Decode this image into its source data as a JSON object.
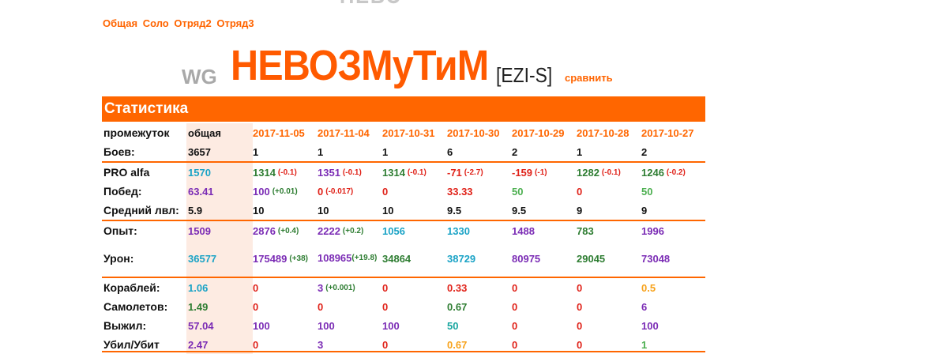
{
  "top_partial_title": "НЕВО",
  "modes": [
    "Общая",
    "Соло",
    "Отряд2",
    "Отряд3"
  ],
  "player": {
    "server": "WG",
    "nickname": "НЕВОЗМуТиМ",
    "clan": "[EZI-S]",
    "compare_label": "сравнить"
  },
  "stats_header": "Статистика",
  "colors": {
    "accent": "#ff6600",
    "black": "#111111",
    "cyan": "#1ba3c6",
    "green": "#2e7d32",
    "lightgreen": "#4caf50",
    "red": "#e0231a",
    "purple": "#7b2cb5",
    "orange": "#f7a21b",
    "teal": "#1aa6a0"
  },
  "table": {
    "columns": [
      "общая",
      "2017-11-05",
      "2017-11-04",
      "2017-10-31",
      "2017-10-30",
      "2017-10-29",
      "2017-10-28",
      "2017-10-27"
    ],
    "rows": [
      {
        "label": "промежуток",
        "kind": "header",
        "cells": [
          {
            "v": "общая",
            "c": "black"
          },
          {
            "v": "2017-11-05",
            "c": "date"
          },
          {
            "v": "2017-11-04",
            "c": "date"
          },
          {
            "v": "2017-10-31",
            "c": "date"
          },
          {
            "v": "2017-10-30",
            "c": "date"
          },
          {
            "v": "2017-10-29",
            "c": "date"
          },
          {
            "v": "2017-10-28",
            "c": "date"
          },
          {
            "v": "2017-10-27",
            "c": "date"
          }
        ]
      },
      {
        "label": "Боев:",
        "cells": [
          {
            "v": "3657",
            "c": "black"
          },
          {
            "v": "1",
            "c": "black"
          },
          {
            "v": "1",
            "c": "black"
          },
          {
            "v": "1",
            "c": "black"
          },
          {
            "v": "6",
            "c": "black"
          },
          {
            "v": "2",
            "c": "black"
          },
          {
            "v": "1",
            "c": "black"
          },
          {
            "v": "2",
            "c": "black"
          }
        ]
      },
      {
        "label": "PRO alfa",
        "divider": true,
        "cells": [
          {
            "v": "1570",
            "c": "cyan"
          },
          {
            "v": "1314",
            "c": "green",
            "d": "(-0.1)",
            "dc": "red"
          },
          {
            "v": "1351",
            "c": "purple",
            "d": "(-0.1)",
            "dc": "red"
          },
          {
            "v": "1314",
            "c": "green",
            "d": "(-0.1)",
            "dc": "red"
          },
          {
            "v": "-71",
            "c": "red",
            "d": "(-2.7)",
            "dc": "red"
          },
          {
            "v": "-159",
            "c": "red",
            "d": "(-1)",
            "dc": "red"
          },
          {
            "v": "1282",
            "c": "green",
            "d": "(-0.1)",
            "dc": "red"
          },
          {
            "v": "1246",
            "c": "green",
            "d": "(-0.2)",
            "dc": "red"
          }
        ]
      },
      {
        "label": "Побед:",
        "cells": [
          {
            "v": "63.41",
            "c": "purple"
          },
          {
            "v": "100",
            "c": "purple",
            "d": "(+0.01)",
            "dc": "green"
          },
          {
            "v": "0",
            "c": "red",
            "d": "(-0.017)",
            "dc": "red"
          },
          {
            "v": "0",
            "c": "red"
          },
          {
            "v": "33.33",
            "c": "red"
          },
          {
            "v": "50",
            "c": "lightgreen"
          },
          {
            "v": "0",
            "c": "red"
          },
          {
            "v": "50",
            "c": "lightgreen"
          }
        ]
      },
      {
        "label": "Средний лвл:",
        "cells": [
          {
            "v": "5.9",
            "c": "black"
          },
          {
            "v": "10",
            "c": "black"
          },
          {
            "v": "10",
            "c": "black"
          },
          {
            "v": "10",
            "c": "black"
          },
          {
            "v": "9.5",
            "c": "black"
          },
          {
            "v": "9.5",
            "c": "black"
          },
          {
            "v": "9",
            "c": "black"
          },
          {
            "v": "9",
            "c": "black"
          }
        ]
      },
      {
        "label": "Опыт:",
        "divider": true,
        "cells": [
          {
            "v": "1509",
            "c": "purple"
          },
          {
            "v": "2876",
            "c": "purple",
            "d": "(+0.4)",
            "dc": "green"
          },
          {
            "v": "2222",
            "c": "purple",
            "d": "(+0.2)",
            "dc": "green"
          },
          {
            "v": "1056",
            "c": "cyan"
          },
          {
            "v": "1330",
            "c": "cyan"
          },
          {
            "v": "1488",
            "c": "purple"
          },
          {
            "v": "783",
            "c": "green"
          },
          {
            "v": "1996",
            "c": "purple"
          }
        ]
      },
      {
        "label": "Урон:",
        "tall": true,
        "cells": [
          {
            "v": "36577",
            "c": "cyan"
          },
          {
            "v": "175489",
            "c": "purple",
            "d": "(+38)",
            "dc": "green"
          },
          {
            "v": "108965",
            "c": "purple",
            "d": "(+19.8)",
            "dc": "green",
            "wrap": true
          },
          {
            "v": "34864",
            "c": "green"
          },
          {
            "v": "38729",
            "c": "cyan"
          },
          {
            "v": "80975",
            "c": "purple"
          },
          {
            "v": "29045",
            "c": "green"
          },
          {
            "v": "73048",
            "c": "purple"
          }
        ]
      },
      {
        "label": "Кораблей:",
        "divider": true,
        "cells": [
          {
            "v": "1.06",
            "c": "cyan"
          },
          {
            "v": "0",
            "c": "red"
          },
          {
            "v": "3",
            "c": "purple",
            "d": "(+0.001)",
            "dc": "green"
          },
          {
            "v": "0",
            "c": "red"
          },
          {
            "v": "0.33",
            "c": "red"
          },
          {
            "v": "0",
            "c": "red"
          },
          {
            "v": "0",
            "c": "red"
          },
          {
            "v": "0.5",
            "c": "orange"
          }
        ]
      },
      {
        "label": "Самолетов:",
        "cells": [
          {
            "v": "1.49",
            "c": "green"
          },
          {
            "v": "0",
            "c": "red"
          },
          {
            "v": "0",
            "c": "red"
          },
          {
            "v": "0",
            "c": "red"
          },
          {
            "v": "0.67",
            "c": "green"
          },
          {
            "v": "0",
            "c": "red"
          },
          {
            "v": "0",
            "c": "red"
          },
          {
            "v": "6",
            "c": "purple"
          }
        ]
      },
      {
        "label": "Выжил:",
        "cells": [
          {
            "v": "57.04",
            "c": "purple"
          },
          {
            "v": "100",
            "c": "purple"
          },
          {
            "v": "100",
            "c": "purple"
          },
          {
            "v": "100",
            "c": "purple"
          },
          {
            "v": "50",
            "c": "teal"
          },
          {
            "v": "0",
            "c": "red"
          },
          {
            "v": "0",
            "c": "red"
          },
          {
            "v": "100",
            "c": "purple"
          }
        ]
      },
      {
        "label": "Убил/Убит",
        "cells": [
          {
            "v": "2.47",
            "c": "purple"
          },
          {
            "v": "0",
            "c": "red"
          },
          {
            "v": "3",
            "c": "purple"
          },
          {
            "v": "0",
            "c": "red"
          },
          {
            "v": "0.67",
            "c": "orange"
          },
          {
            "v": "0",
            "c": "red"
          },
          {
            "v": "0",
            "c": "red"
          },
          {
            "v": "1",
            "c": "lightgreen"
          }
        ]
      }
    ]
  }
}
